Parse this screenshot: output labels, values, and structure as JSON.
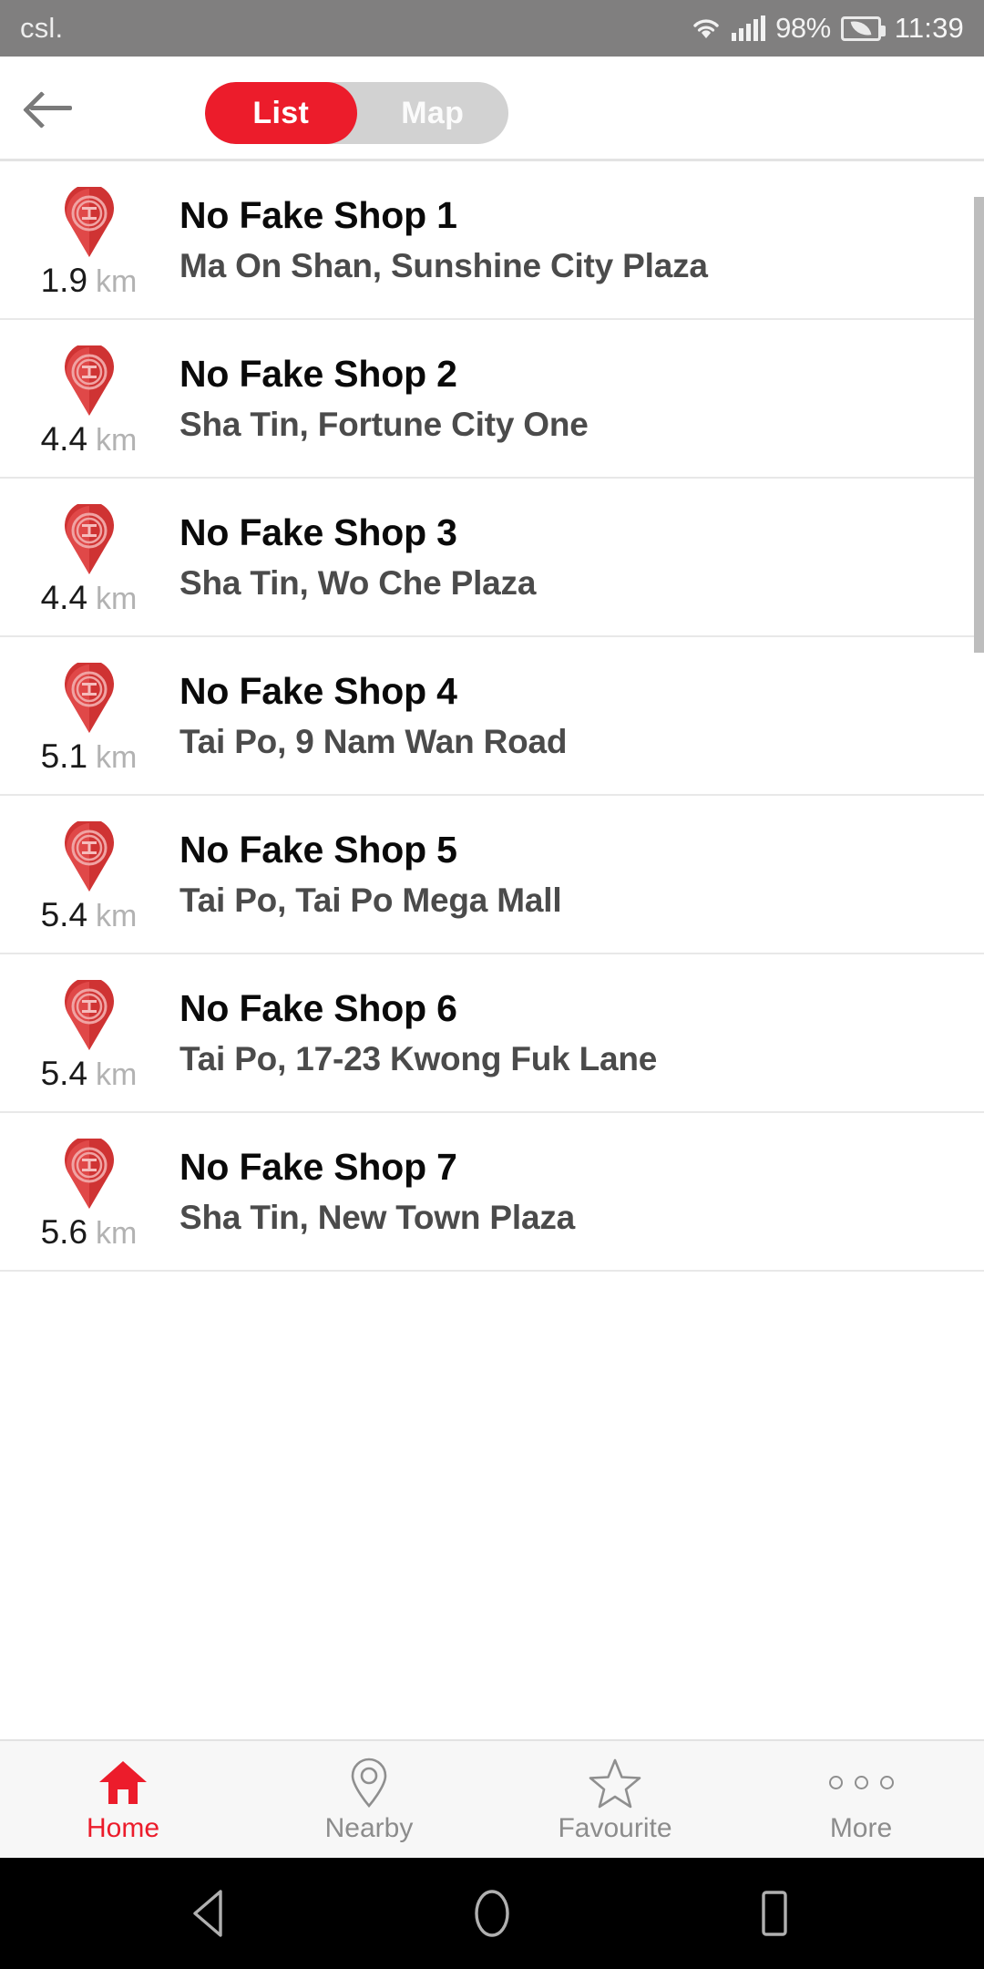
{
  "status_bar": {
    "carrier": "csl.",
    "battery_percent": "98%",
    "time": "11:39",
    "icons": [
      "wifi-icon",
      "signal-bars-icon",
      "battery-saver-icon"
    ]
  },
  "toolbar": {
    "back_icon": "back-arrow-icon",
    "segments": [
      {
        "label": "List",
        "active": true
      },
      {
        "label": "Map",
        "active": false
      }
    ]
  },
  "list": {
    "pin_icon": "no-fake-shop-pin-icon",
    "distance_unit": "km",
    "items": [
      {
        "name": "No Fake Shop 1",
        "distance": "1.9",
        "unit": "km",
        "address": "Ma On Shan, Sunshine City Plaza"
      },
      {
        "name": "No Fake Shop 2",
        "distance": "4.4",
        "unit": "km",
        "address": "Sha Tin, Fortune City One"
      },
      {
        "name": "No Fake Shop 3",
        "distance": "4.4",
        "unit": "km",
        "address": "Sha Tin, Wo Che Plaza"
      },
      {
        "name": "No Fake Shop 4",
        "distance": "5.1",
        "unit": "km",
        "address": "Tai Po, 9 Nam Wan Road"
      },
      {
        "name": "No Fake Shop 5",
        "distance": "5.4",
        "unit": "km",
        "address": "Tai Po, Tai Po Mega Mall"
      },
      {
        "name": "No Fake Shop 6",
        "distance": "5.4",
        "unit": "km",
        "address": "Tai Po, 17-23 Kwong Fuk Lane"
      },
      {
        "name": "No Fake Shop 7",
        "distance": "5.6",
        "unit": "km",
        "address": "Sha Tin, New Town Plaza"
      }
    ]
  },
  "tabbar": {
    "tabs": [
      {
        "label": "Home",
        "icon": "home-icon",
        "active": true
      },
      {
        "label": "Nearby",
        "icon": "map-pin-outline-icon",
        "active": false
      },
      {
        "label": "Favourite",
        "icon": "star-outline-icon",
        "active": false
      },
      {
        "label": "More",
        "icon": "more-dots-icon",
        "active": false
      }
    ]
  },
  "android_nav": {
    "buttons": [
      "back-triangle-icon",
      "home-circle-icon",
      "recents-square-icon"
    ]
  },
  "colors": {
    "accent_red": "#ec1c2b",
    "statusbar_gray": "#807f7f",
    "inactive_gray": "#8c8c8c",
    "segment_track": "#d2d2d2"
  }
}
